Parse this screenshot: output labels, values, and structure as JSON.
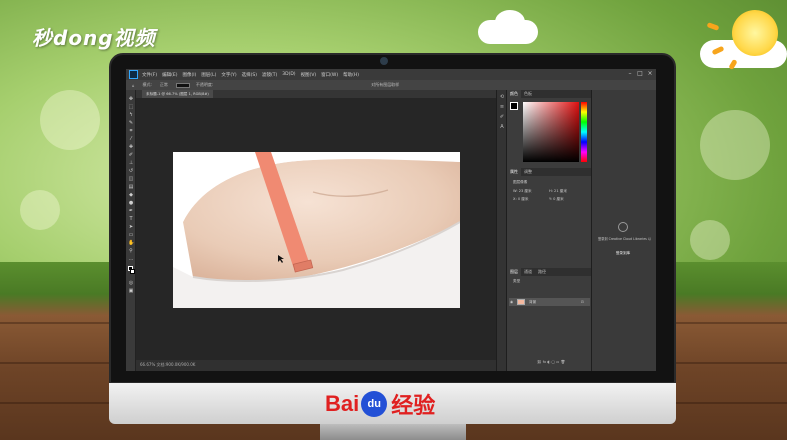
{
  "watermark": {
    "logo_text": "秒dong视频"
  },
  "brand": {
    "bai": "Bai",
    "du": "du",
    "jingyan": "经验"
  },
  "photoshop": {
    "menu": [
      "文件(F)",
      "编辑(E)",
      "图像(I)",
      "图层(L)",
      "文字(Y)",
      "选择(S)",
      "滤镜(T)",
      "3D(D)",
      "视图(V)",
      "窗口(W)",
      "帮助(H)"
    ],
    "options": {
      "mode_label": "模式:",
      "mode_value": "正常",
      "opacity_label": "不透明度:",
      "right_label": "对所有图层取样"
    },
    "doc_tab": "未标题-1 @ 66.7% (图层 1, RGB/8#)",
    "status": "66.67%   文档:900.0K/900.0K",
    "color_tabs": [
      "颜色",
      "色板"
    ],
    "props_tabs": [
      "属性",
      "调整"
    ],
    "props_text": [
      "图层像素",
      "W: 23 厘米",
      "H: 21 厘米",
      "X: 0 厘米",
      "Y: 0 厘米"
    ],
    "layers_tabs": [
      "图层",
      "通道",
      "路径"
    ],
    "layers_filter": "类型",
    "layer_name": "背景",
    "cc_text": "登录到 Creative Cloud Libraries 以",
    "cc_button": "登录到库"
  },
  "colors": {
    "strap": "#f08a72",
    "accent": "#31a8ff"
  }
}
